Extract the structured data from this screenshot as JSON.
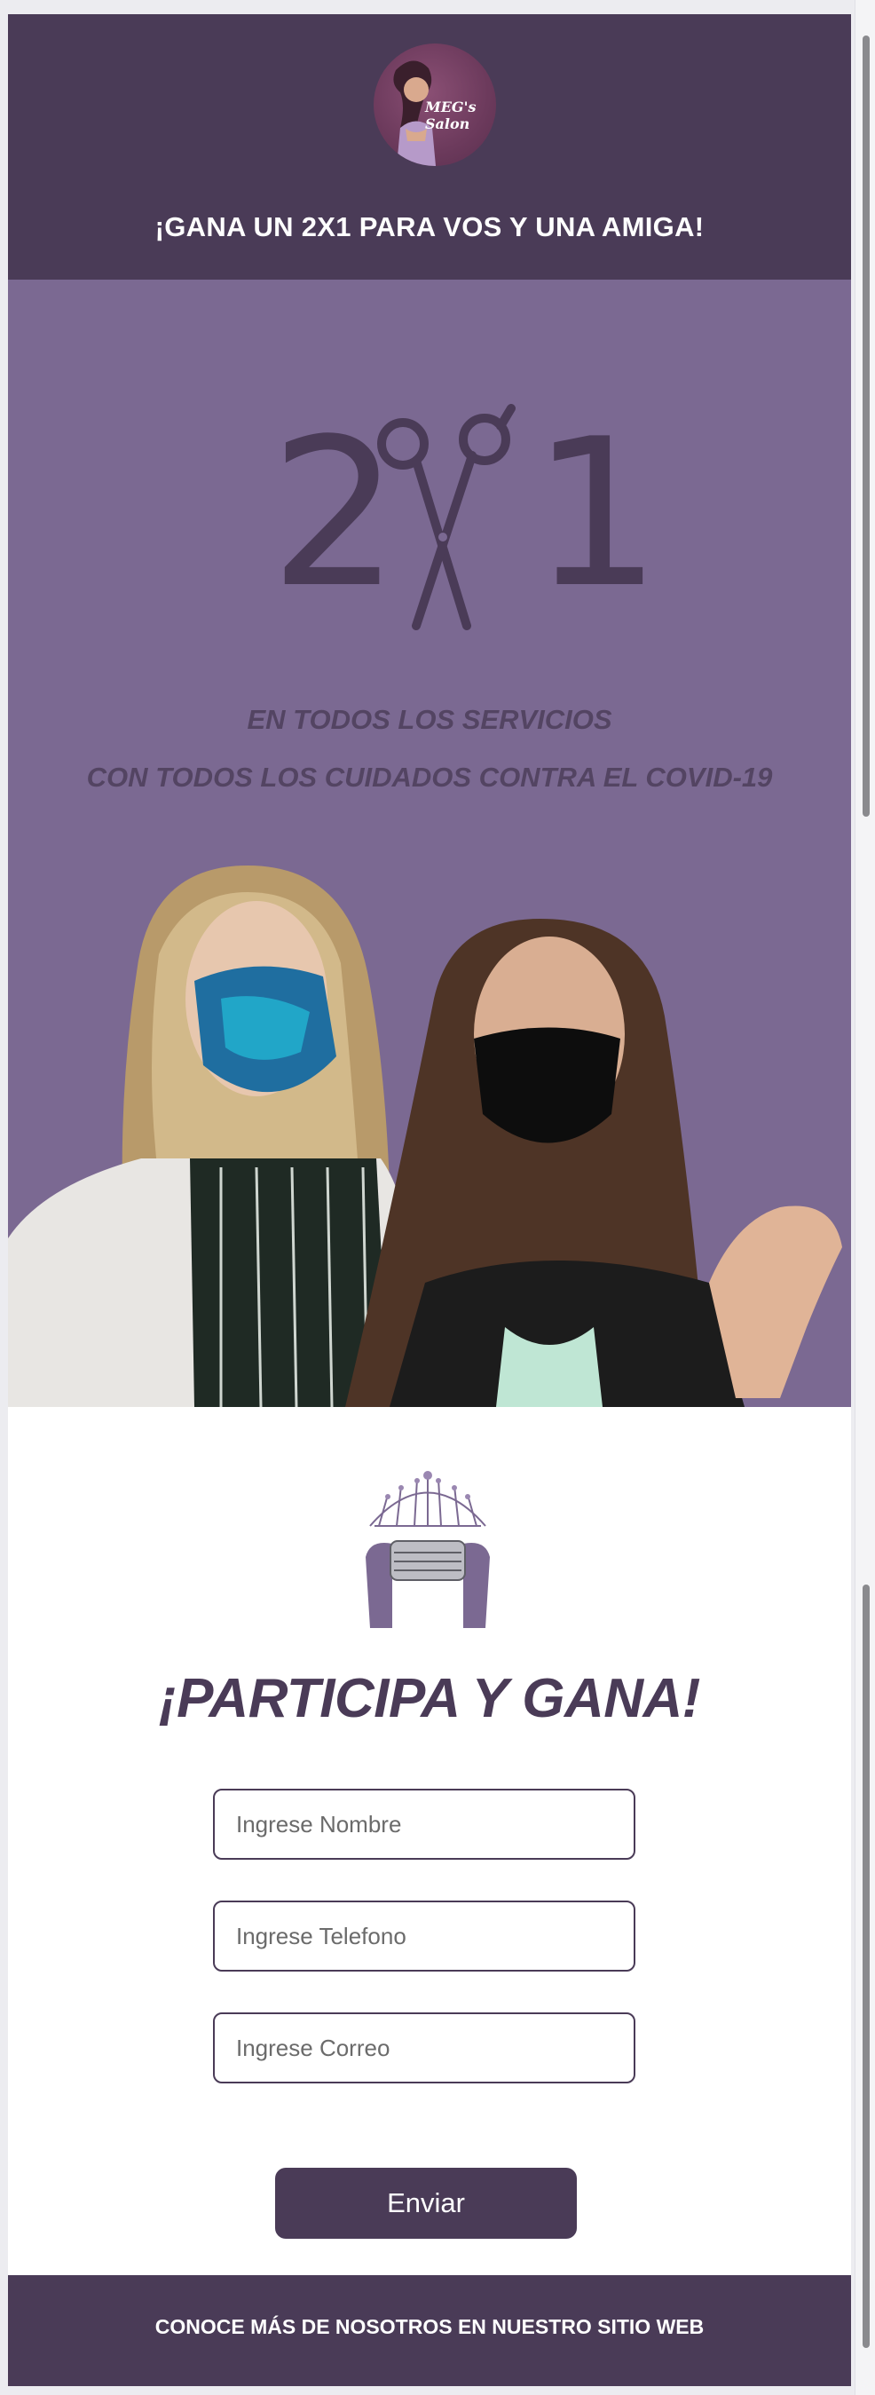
{
  "header": {
    "logo_text": "MEG's Salon",
    "title": "¡GANA UN 2X1 PARA VOS Y UNA AMIGA!"
  },
  "hero": {
    "promo_left": "2",
    "promo_right": "1",
    "line1": "EN TODOS LOS SERVICIOS",
    "line2": "CON TODOS LOS CUIDADOS CONTRA EL COVID-19"
  },
  "form": {
    "title": "¡PARTICIPA Y GANA!",
    "name_placeholder": "Ingrese Nombre",
    "phone_placeholder": "Ingrese Telefono",
    "email_placeholder": "Ingrese Correo",
    "submit_label": "Enviar"
  },
  "footer": {
    "link_label": "CONOCE MÁS DE NOSOTROS EN NUESTRO SITIO WEB"
  },
  "colors": {
    "brand_dark": "#4a3b57",
    "hero_bg": "#7b6992"
  }
}
